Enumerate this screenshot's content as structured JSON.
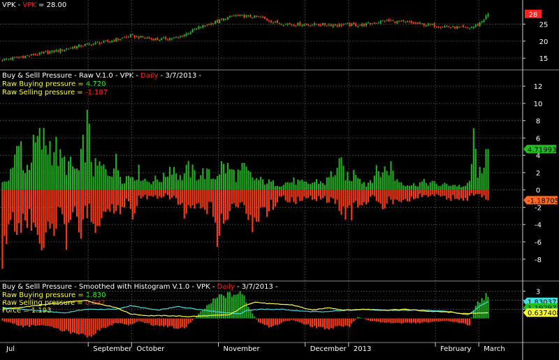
{
  "colors": {
    "up": "#20b020",
    "down": "#ff3a12",
    "cyan": "#40e0e0",
    "yellow": "#ffff30",
    "grid": "#3a3a3a",
    "axis": "#ffffff",
    "red_text": "#ff2020",
    "green_text": "#20ff20"
  },
  "price_panel": {
    "title_symbol": "VPK",
    "title_dash": " - ",
    "title_symbol_red": "VPK",
    "title_eq": " = 28.00",
    "last_label": "28"
  },
  "raw_panel": {
    "title_main": "Buy & Selll Pressure - Raw V.1.0  - VPK - ",
    "title_period": "Daily",
    "title_date": " - 3/7/2013 -",
    "buy_label": "Raw Buying pressure = ",
    "buy_value": "4.720",
    "sell_label": "Raw Selling pressure = ",
    "sell_value": "-1.187",
    "buy_badge": "4.71993",
    "sell_badge": "-1.18705"
  },
  "smooth_panel": {
    "title_main": "Buy & Selll Pressure - Smoothed with Histogram V.1.0  - VPK - ",
    "title_period": "Daily",
    "title_date": " - 3/7/2013 -",
    "buy_label": "Raw Buying pressure = ",
    "buy_value": "1.830",
    "sell_label": "Raw Selling pressure = ",
    "sell_value": "0.637",
    "force_label": "Force = ",
    "force_value": "1.193",
    "buy_badge": "1.83037",
    "force_badge": "1.19297",
    "sell_badge": "0.637408"
  },
  "x_axis_labels": [
    {
      "text": "Jul",
      "i": 0
    },
    {
      "text": "September",
      "i": 42
    },
    {
      "text": "October",
      "i": 63
    },
    {
      "text": "November",
      "i": 105
    },
    {
      "text": "December",
      "i": 147
    },
    {
      "text": "2013",
      "i": 168
    },
    {
      "text": "February",
      "i": 210
    },
    {
      "text": "March",
      "i": 231
    }
  ],
  "chart_data": [
    {
      "type": "candlestick",
      "title": "VPK - VPK = 28.00",
      "y_ticks": [
        15,
        20,
        25
      ],
      "ylim": [
        13.2,
        29.2
      ],
      "close_keypoints": [
        [
          0,
          14.5
        ],
        [
          15,
          16.0
        ],
        [
          25,
          17.0
        ],
        [
          38,
          18.7
        ],
        [
          52,
          20.0
        ],
        [
          62,
          21.5
        ],
        [
          75,
          20.5
        ],
        [
          85,
          21.0
        ],
        [
          95,
          24.0
        ],
        [
          105,
          26.0
        ],
        [
          112,
          27.5
        ],
        [
          125,
          27.0
        ],
        [
          132,
          25.5
        ],
        [
          138,
          25.0
        ],
        [
          160,
          24.8
        ],
        [
          175,
          24.8
        ],
        [
          185,
          26.0
        ],
        [
          195,
          25.5
        ],
        [
          210,
          24.5
        ],
        [
          220,
          24.0
        ],
        [
          226,
          23.8
        ],
        [
          230,
          24.8
        ],
        [
          233,
          26.5
        ],
        [
          235,
          28.0
        ]
      ]
    },
    {
      "type": "bar",
      "title": "Buy & Selll Pressure - Raw V.1.0",
      "series": [
        {
          "name": "Raw Buying pressure",
          "color": "#20b020"
        },
        {
          "name": "Raw Selling pressure",
          "color": "#ff3a12"
        }
      ],
      "y_ticks": [
        -8,
        -6,
        -4,
        -2,
        0,
        2,
        4,
        6,
        8,
        10,
        12
      ],
      "ylim": [
        -10.2,
        12.9
      ],
      "buy_peaks": [
        [
          1,
          1
        ],
        [
          4,
          3.5
        ],
        [
          7,
          6
        ],
        [
          9,
          7.5
        ],
        [
          11,
          3
        ],
        [
          14,
          6
        ],
        [
          17,
          8
        ],
        [
          20,
          8
        ],
        [
          25,
          7.5
        ],
        [
          28,
          5
        ],
        [
          33,
          4
        ],
        [
          37,
          3
        ],
        [
          41,
          10.5
        ],
        [
          44,
          3.5
        ],
        [
          47,
          4
        ],
        [
          51,
          3
        ],
        [
          55,
          4.5
        ],
        [
          58,
          2
        ],
        [
          62,
          2.5
        ],
        [
          66,
          3
        ],
        [
          70,
          1.5
        ],
        [
          78,
          2
        ],
        [
          82,
          4.5
        ],
        [
          86,
          2
        ],
        [
          90,
          3.5
        ],
        [
          94,
          2.5
        ],
        [
          98,
          3
        ],
        [
          102,
          2
        ],
        [
          106,
          4
        ],
        [
          110,
          3.5
        ],
        [
          113,
          2.5
        ],
        [
          117,
          3.5
        ],
        [
          121,
          2
        ],
        [
          126,
          1.5
        ],
        [
          134,
          1
        ],
        [
          141,
          1.5
        ],
        [
          148,
          1
        ],
        [
          152,
          1.5
        ],
        [
          156,
          1.2
        ],
        [
          160,
          3
        ],
        [
          164,
          4
        ],
        [
          168,
          1.5
        ],
        [
          171,
          3.5
        ],
        [
          176,
          0.8
        ],
        [
          180,
          2.8
        ],
        [
          184,
          3.2
        ],
        [
          188,
          4
        ],
        [
          190,
          2
        ],
        [
          194,
          1.2
        ],
        [
          198,
          0.8
        ],
        [
          203,
          1.3
        ],
        [
          208,
          1.2
        ],
        [
          212,
          0.8
        ],
        [
          216,
          1
        ],
        [
          220,
          0.8
        ],
        [
          224,
          0.5
        ],
        [
          226,
          1.5
        ],
        [
          228,
          8
        ],
        [
          229,
          6
        ],
        [
          230,
          3.5
        ],
        [
          232,
          2
        ],
        [
          234,
          4.72
        ],
        [
          235,
          4.72
        ]
      ],
      "sell_peaks": [
        [
          2,
          -9.5
        ],
        [
          5,
          -5
        ],
        [
          8,
          -7.5
        ],
        [
          10,
          -4
        ],
        [
          13,
          -6
        ],
        [
          16,
          -4.5
        ],
        [
          19,
          -8.5
        ],
        [
          22,
          -6
        ],
        [
          26,
          -5.5
        ],
        [
          29,
          -3
        ],
        [
          32,
          -9.5
        ],
        [
          35,
          -5
        ],
        [
          38,
          -8
        ],
        [
          40,
          -3
        ],
        [
          45,
          -5
        ],
        [
          48,
          -4.5
        ],
        [
          52,
          -3
        ],
        [
          55,
          -4
        ],
        [
          60,
          -2
        ],
        [
          63,
          -3.5
        ],
        [
          67,
          -1
        ],
        [
          72,
          -1.5
        ],
        [
          76,
          -1.5
        ],
        [
          80,
          -1
        ],
        [
          84,
          -1.5
        ],
        [
          88,
          -4
        ],
        [
          91,
          -3
        ],
        [
          96,
          -4
        ],
        [
          100,
          -3
        ],
        [
          103,
          -5
        ],
        [
          105,
          -8.2
        ],
        [
          108,
          -4
        ],
        [
          111,
          -3
        ],
        [
          115,
          -2
        ],
        [
          119,
          -5
        ],
        [
          122,
          -6.5
        ],
        [
          125,
          -2.5
        ],
        [
          128,
          -3.5
        ],
        [
          132,
          -2
        ],
        [
          136,
          -1.5
        ],
        [
          140,
          -1.5
        ],
        [
          145,
          -2
        ],
        [
          150,
          -1.2
        ],
        [
          156,
          -1.5
        ],
        [
          161,
          -2.5
        ],
        [
          165,
          -3.5
        ],
        [
          168,
          -3.9
        ],
        [
          172,
          -2.5
        ],
        [
          176,
          -2
        ],
        [
          179,
          -1
        ],
        [
          183,
          -3
        ],
        [
          187,
          -2
        ],
        [
          190,
          -1.5
        ],
        [
          195,
          -1.5
        ],
        [
          200,
          -1.2
        ],
        [
          205,
          -1
        ],
        [
          209,
          -0.8
        ],
        [
          214,
          -1.5
        ],
        [
          218,
          -1.2
        ],
        [
          222,
          -1.5
        ],
        [
          225,
          -1.5
        ],
        [
          229,
          -0.5
        ],
        [
          232,
          -1
        ],
        [
          235,
          -1.19
        ]
      ]
    },
    {
      "type": "bar",
      "title": "Buy & Selll Pressure - Smoothed with Histogram V.1.0",
      "series": [
        {
          "name": "Force histogram",
          "color": "#20b020"
        },
        {
          "name": "Raw Buying pressure",
          "color": "#40e0e0"
        },
        {
          "name": "Raw Selling pressure",
          "color": "#ffff30"
        }
      ],
      "y_ticks": [
        1.0,
        2.0,
        3.0
      ],
      "ylim": [
        -2.5,
        3.5
      ],
      "hist_keypoints": [
        [
          0,
          -0.3
        ],
        [
          10,
          -1.0
        ],
        [
          20,
          -0.8
        ],
        [
          30,
          -1.6
        ],
        [
          40,
          -1.9
        ],
        [
          42,
          -2.3
        ],
        [
          48,
          -1.3
        ],
        [
          55,
          -0.6
        ],
        [
          62,
          -0.8
        ],
        [
          66,
          -0.3
        ],
        [
          72,
          -0.8
        ],
        [
          80,
          -1.0
        ],
        [
          88,
          -1.3
        ],
        [
          94,
          0.3
        ],
        [
          100,
          1.8
        ],
        [
          105,
          2.8
        ],
        [
          110,
          3.0
        ],
        [
          115,
          3.1
        ],
        [
          117,
          2.8
        ],
        [
          120,
          1.0
        ],
        [
          124,
          -0.5
        ],
        [
          130,
          -1.2
        ],
        [
          135,
          -0.5
        ],
        [
          140,
          -0.2
        ],
        [
          150,
          -1.0
        ],
        [
          158,
          -1.4
        ],
        [
          162,
          -1.0
        ],
        [
          168,
          -1.0
        ],
        [
          172,
          0.2
        ],
        [
          178,
          -0.3
        ],
        [
          185,
          -0.5
        ],
        [
          195,
          -0.6
        ],
        [
          205,
          -0.5
        ],
        [
          215,
          -0.3
        ],
        [
          222,
          -0.6
        ],
        [
          226,
          -0.8
        ],
        [
          228,
          1.0
        ],
        [
          230,
          2.0
        ],
        [
          233,
          2.5
        ],
        [
          235,
          3.1
        ]
      ],
      "cyan_keypoints": [
        [
          0,
          1.2
        ],
        [
          15,
          0.9
        ],
        [
          30,
          0.6
        ],
        [
          40,
          1.0
        ],
        [
          55,
          1.0
        ],
        [
          62,
          1.4
        ],
        [
          75,
          0.9
        ],
        [
          85,
          1.3
        ],
        [
          95,
          1.0
        ],
        [
          105,
          0.7
        ],
        [
          115,
          0.5
        ],
        [
          118,
          0.9
        ],
        [
          125,
          1.0
        ],
        [
          135,
          1.0
        ],
        [
          145,
          0.8
        ],
        [
          155,
          0.7
        ],
        [
          165,
          0.9
        ],
        [
          175,
          1.0
        ],
        [
          185,
          0.9
        ],
        [
          195,
          0.9
        ],
        [
          205,
          0.9
        ],
        [
          215,
          0.8
        ],
        [
          225,
          0.4
        ],
        [
          228,
          0.8
        ],
        [
          231,
          1.4
        ],
        [
          235,
          1.83
        ]
      ],
      "yellow_keypoints": [
        [
          0,
          1.0
        ],
        [
          20,
          1.5
        ],
        [
          40,
          2.0
        ],
        [
          45,
          1.7
        ],
        [
          55,
          1.2
        ],
        [
          62,
          0.5
        ],
        [
          70,
          0.3
        ],
        [
          80,
          0.3
        ],
        [
          90,
          0.2
        ],
        [
          100,
          0.3
        ],
        [
          110,
          0.4
        ],
        [
          118,
          1.5
        ],
        [
          122,
          1.8
        ],
        [
          130,
          1.6
        ],
        [
          140,
          1.5
        ],
        [
          150,
          0.9
        ],
        [
          158,
          1.2
        ],
        [
          165,
          0.9
        ],
        [
          175,
          1.0
        ],
        [
          185,
          0.9
        ],
        [
          195,
          1.0
        ],
        [
          205,
          0.8
        ],
        [
          215,
          0.7
        ],
        [
          225,
          0.5
        ],
        [
          230,
          0.6
        ],
        [
          235,
          0.64
        ]
      ]
    }
  ]
}
